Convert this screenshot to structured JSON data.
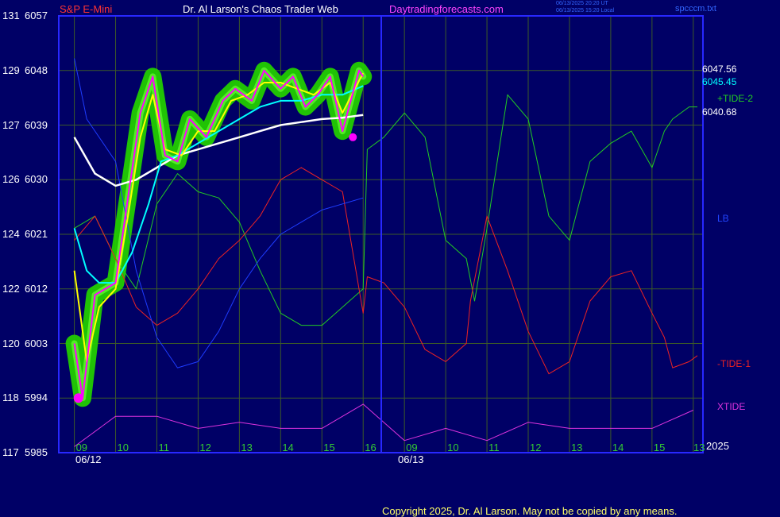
{
  "header": {
    "symbol": "S&P E-Mini",
    "title": "Dr. Al Larson's Chaos Trader Web",
    "site": "Daytradingforecasts.com",
    "utc_time": "06/13/2025 20:20 UT",
    "local_time": "06/13/2025 15:20 Local",
    "file": "spcccm.txt"
  },
  "colors": {
    "background": "#000066",
    "frame": "#2828ff",
    "grid": "#3c5a28",
    "price": "#ff00ff",
    "ma_fast": "#ffff00",
    "ma_mid": "#00ffff",
    "ma_slow": "#ffffff",
    "tide_plus2": "#22cc22",
    "tide_minus1": "#ee2222",
    "lb": "#1e3cff",
    "xtide": "#dd33dd",
    "halo": "#22cc00",
    "halo_light": "#66ff33"
  },
  "y_axis": [
    {
      "tide": "131",
      "price": "6057"
    },
    {
      "tide": "129",
      "price": "6048"
    },
    {
      "tide": "127",
      "price": "6039"
    },
    {
      "tide": "126",
      "price": "6030"
    },
    {
      "tide": "124",
      "price": "6021"
    },
    {
      "tide": "122",
      "price": "6012"
    },
    {
      "tide": "120",
      "price": "6003"
    },
    {
      "tide": "118",
      "price": "5994"
    },
    {
      "tide": "117",
      "price": "5985"
    }
  ],
  "x_axis": {
    "hours": [
      "09",
      "10",
      "11",
      "12",
      "13",
      "14",
      "15",
      "16",
      "09",
      "10",
      "11",
      "12",
      "13",
      "14",
      "15",
      "13"
    ],
    "dates": [
      "06/12",
      "06/13"
    ],
    "year": "2025"
  },
  "right_labels": {
    "price_ma_fast": "6047.56",
    "price_ma_mid": "6045.45",
    "price_ma_slow": "6040.68",
    "tide_plus2": "+TIDE-2",
    "lb": "LB",
    "tide_minus1": "-TIDE-1",
    "xtide": "XTIDE"
  },
  "copyright": "Copyright 2025, Dr. Al Larson. May not be copied by any means.",
  "chart_data": {
    "type": "line",
    "ylim": [
      5985,
      6057
    ],
    "series": [
      {
        "name": "S&P E-Mini",
        "x": [
          9.0,
          9.2,
          9.5,
          10.0,
          10.3,
          10.6,
          10.9,
          11.2,
          11.5,
          11.8,
          12.2,
          12.6,
          12.9,
          13.3,
          13.6,
          14.0,
          14.3,
          14.6,
          14.9,
          15.2,
          15.5,
          15.7,
          15.9,
          16.0
        ],
        "values": [
          6003,
          5994,
          6011,
          6013,
          6027,
          6041,
          6047,
          6034,
          6033,
          6040,
          6037,
          6043,
          6045,
          6043,
          6048,
          6045,
          6047,
          6042,
          6044,
          6047,
          6038,
          6043,
          6048,
          6047
        ]
      },
      {
        "name": "6047.56",
        "x": [
          9.0,
          9.3,
          9.6,
          10.0,
          10.3,
          10.6,
          10.9,
          11.2,
          11.6,
          12.0,
          12.4,
          12.8,
          13.2,
          13.6,
          14.0,
          14.4,
          14.8,
          15.2,
          15.5,
          15.8,
          16.0
        ],
        "values": [
          6015,
          6000,
          6009,
          6012,
          6024,
          6037,
          6044,
          6035,
          6034,
          6038,
          6038,
          6043,
          6044,
          6046,
          6046,
          6045,
          6044,
          6046,
          6041,
          6045,
          6047.56
        ]
      },
      {
        "name": "6045.45",
        "x": [
          9.0,
          9.3,
          9.6,
          10.0,
          10.4,
          10.8,
          11.1,
          11.5,
          12.0,
          12.5,
          13.0,
          13.5,
          14.0,
          14.5,
          15.0,
          15.5,
          16.0
        ],
        "values": [
          6022,
          6015,
          6013,
          6013,
          6018,
          6026,
          6033,
          6034,
          6036,
          6038,
          6040,
          6042,
          6043,
          6043,
          6044,
          6044,
          6045.45
        ]
      },
      {
        "name": "6040.68",
        "x": [
          9.0,
          9.5,
          10.0,
          10.5,
          11.0,
          11.5,
          12.0,
          12.5,
          13.0,
          13.5,
          14.0,
          14.5,
          15.0,
          15.5,
          16.0
        ],
        "values": [
          6037,
          6031,
          6029,
          6030,
          6032,
          6034,
          6035,
          6036,
          6037,
          6038,
          6039,
          6039.5,
          6040,
          6040.2,
          6040.68
        ]
      },
      {
        "name": "+TIDE-2",
        "x": [
          9.0,
          9.5,
          10.0,
          10.5,
          11.0,
          11.5,
          12.0,
          12.5,
          13.0,
          13.5,
          14.0,
          14.5,
          15.0,
          15.5,
          16.0,
          16.1,
          16.5,
          17.0,
          17.5,
          18.0,
          18.5,
          18.7,
          19.0,
          19.5,
          20.0,
          20.5,
          21.0,
          21.5,
          22.0,
          22.5,
          23.0,
          23.3,
          23.5,
          23.9,
          24.1
        ],
        "values": [
          6022,
          6024,
          6017,
          6012,
          6026,
          6031,
          6028,
          6027,
          6023,
          6015,
          6008,
          6006,
          6006,
          6009,
          6012,
          6035,
          6037,
          6041,
          6037,
          6020,
          6017,
          6010,
          6022,
          6044,
          6040,
          6024,
          6020,
          6033,
          6036,
          6038,
          6032,
          6038,
          6040,
          6042,
          6042
        ]
      },
      {
        "name": "-TIDE-1",
        "x": [
          9.0,
          9.5,
          10.0,
          10.5,
          11.0,
          11.5,
          12.0,
          12.5,
          13.0,
          13.5,
          14.0,
          14.5,
          15.0,
          15.5,
          16.0,
          16.1,
          16.5,
          17.0,
          17.5,
          18.0,
          18.5,
          18.6,
          19.0,
          19.5,
          20.0,
          20.5,
          21.0,
          21.5,
          22.0,
          22.5,
          23.0,
          23.3,
          23.5,
          23.9,
          24.1
        ],
        "values": [
          6020,
          6024,
          6017,
          6009,
          6006,
          6008,
          6012,
          6017,
          6020,
          6024,
          6030,
          6032,
          6030,
          6028,
          6008,
          6014,
          6013,
          6009,
          6002,
          6000,
          6003,
          6010,
          6024,
          6015,
          6005,
          5998,
          6000,
          6010,
          6014,
          6015,
          6008,
          6004,
          5999,
          6000,
          6001
        ]
      },
      {
        "name": "LB",
        "x": [
          9.0,
          9.3,
          9.5,
          10.0,
          10.5,
          11.0,
          11.5,
          12.0,
          12.5,
          13.0,
          13.5,
          14.0,
          14.5,
          15.0,
          15.5,
          16.0
        ],
        "values": [
          6050,
          6040,
          6038,
          6033,
          6015,
          6004,
          5999,
          6000,
          6005,
          6012,
          6017,
          6021,
          6023,
          6025,
          6026,
          6027
        ]
      },
      {
        "name": "XTIDE",
        "x": [
          9.0,
          10.0,
          11.0,
          12.0,
          13.0,
          14.0,
          15.0,
          16.0,
          17.0,
          18.0,
          19.0,
          20.0,
          21.0,
          22.0,
          23.0,
          24.0
        ],
        "values": [
          5986,
          5991,
          5991,
          5989,
          5990,
          5989,
          5989,
          5993,
          5987,
          5989,
          5987,
          5990,
          5989,
          5989,
          5989,
          5992
        ]
      }
    ]
  }
}
